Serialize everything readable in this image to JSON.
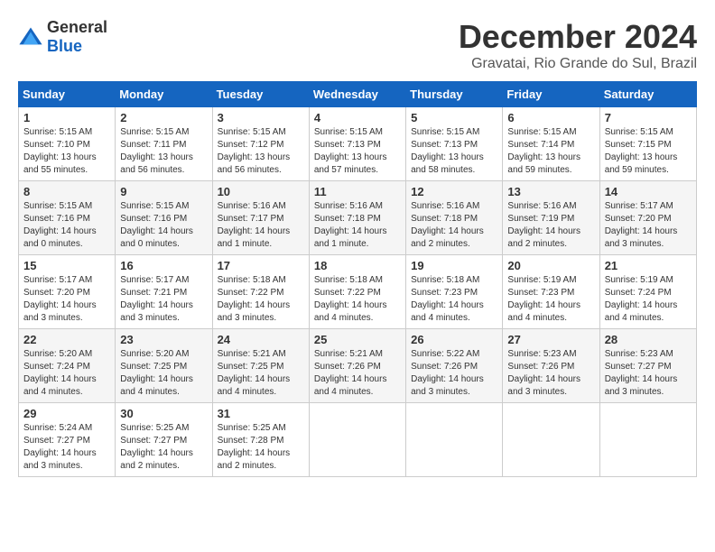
{
  "header": {
    "logo": {
      "general": "General",
      "blue": "Blue"
    },
    "title": "December 2024",
    "location": "Gravatai, Rio Grande do Sul, Brazil"
  },
  "weekdays": [
    "Sunday",
    "Monday",
    "Tuesday",
    "Wednesday",
    "Thursday",
    "Friday",
    "Saturday"
  ],
  "weeks": [
    [
      {
        "day": "1",
        "sunrise": "Sunrise: 5:15 AM",
        "sunset": "Sunset: 7:10 PM",
        "daylight": "Daylight: 13 hours and 55 minutes."
      },
      {
        "day": "2",
        "sunrise": "Sunrise: 5:15 AM",
        "sunset": "Sunset: 7:11 PM",
        "daylight": "Daylight: 13 hours and 56 minutes."
      },
      {
        "day": "3",
        "sunrise": "Sunrise: 5:15 AM",
        "sunset": "Sunset: 7:12 PM",
        "daylight": "Daylight: 13 hours and 56 minutes."
      },
      {
        "day": "4",
        "sunrise": "Sunrise: 5:15 AM",
        "sunset": "Sunset: 7:13 PM",
        "daylight": "Daylight: 13 hours and 57 minutes."
      },
      {
        "day": "5",
        "sunrise": "Sunrise: 5:15 AM",
        "sunset": "Sunset: 7:13 PM",
        "daylight": "Daylight: 13 hours and 58 minutes."
      },
      {
        "day": "6",
        "sunrise": "Sunrise: 5:15 AM",
        "sunset": "Sunset: 7:14 PM",
        "daylight": "Daylight: 13 hours and 59 minutes."
      },
      {
        "day": "7",
        "sunrise": "Sunrise: 5:15 AM",
        "sunset": "Sunset: 7:15 PM",
        "daylight": "Daylight: 13 hours and 59 minutes."
      }
    ],
    [
      {
        "day": "8",
        "sunrise": "Sunrise: 5:15 AM",
        "sunset": "Sunset: 7:16 PM",
        "daylight": "Daylight: 14 hours and 0 minutes."
      },
      {
        "day": "9",
        "sunrise": "Sunrise: 5:15 AM",
        "sunset": "Sunset: 7:16 PM",
        "daylight": "Daylight: 14 hours and 0 minutes."
      },
      {
        "day": "10",
        "sunrise": "Sunrise: 5:16 AM",
        "sunset": "Sunset: 7:17 PM",
        "daylight": "Daylight: 14 hours and 1 minute."
      },
      {
        "day": "11",
        "sunrise": "Sunrise: 5:16 AM",
        "sunset": "Sunset: 7:18 PM",
        "daylight": "Daylight: 14 hours and 1 minute."
      },
      {
        "day": "12",
        "sunrise": "Sunrise: 5:16 AM",
        "sunset": "Sunset: 7:18 PM",
        "daylight": "Daylight: 14 hours and 2 minutes."
      },
      {
        "day": "13",
        "sunrise": "Sunrise: 5:16 AM",
        "sunset": "Sunset: 7:19 PM",
        "daylight": "Daylight: 14 hours and 2 minutes."
      },
      {
        "day": "14",
        "sunrise": "Sunrise: 5:17 AM",
        "sunset": "Sunset: 7:20 PM",
        "daylight": "Daylight: 14 hours and 3 minutes."
      }
    ],
    [
      {
        "day": "15",
        "sunrise": "Sunrise: 5:17 AM",
        "sunset": "Sunset: 7:20 PM",
        "daylight": "Daylight: 14 hours and 3 minutes."
      },
      {
        "day": "16",
        "sunrise": "Sunrise: 5:17 AM",
        "sunset": "Sunset: 7:21 PM",
        "daylight": "Daylight: 14 hours and 3 minutes."
      },
      {
        "day": "17",
        "sunrise": "Sunrise: 5:18 AM",
        "sunset": "Sunset: 7:22 PM",
        "daylight": "Daylight: 14 hours and 3 minutes."
      },
      {
        "day": "18",
        "sunrise": "Sunrise: 5:18 AM",
        "sunset": "Sunset: 7:22 PM",
        "daylight": "Daylight: 14 hours and 4 minutes."
      },
      {
        "day": "19",
        "sunrise": "Sunrise: 5:18 AM",
        "sunset": "Sunset: 7:23 PM",
        "daylight": "Daylight: 14 hours and 4 minutes."
      },
      {
        "day": "20",
        "sunrise": "Sunrise: 5:19 AM",
        "sunset": "Sunset: 7:23 PM",
        "daylight": "Daylight: 14 hours and 4 minutes."
      },
      {
        "day": "21",
        "sunrise": "Sunrise: 5:19 AM",
        "sunset": "Sunset: 7:24 PM",
        "daylight": "Daylight: 14 hours and 4 minutes."
      }
    ],
    [
      {
        "day": "22",
        "sunrise": "Sunrise: 5:20 AM",
        "sunset": "Sunset: 7:24 PM",
        "daylight": "Daylight: 14 hours and 4 minutes."
      },
      {
        "day": "23",
        "sunrise": "Sunrise: 5:20 AM",
        "sunset": "Sunset: 7:25 PM",
        "daylight": "Daylight: 14 hours and 4 minutes."
      },
      {
        "day": "24",
        "sunrise": "Sunrise: 5:21 AM",
        "sunset": "Sunset: 7:25 PM",
        "daylight": "Daylight: 14 hours and 4 minutes."
      },
      {
        "day": "25",
        "sunrise": "Sunrise: 5:21 AM",
        "sunset": "Sunset: 7:26 PM",
        "daylight": "Daylight: 14 hours and 4 minutes."
      },
      {
        "day": "26",
        "sunrise": "Sunrise: 5:22 AM",
        "sunset": "Sunset: 7:26 PM",
        "daylight": "Daylight: 14 hours and 3 minutes."
      },
      {
        "day": "27",
        "sunrise": "Sunrise: 5:23 AM",
        "sunset": "Sunset: 7:26 PM",
        "daylight": "Daylight: 14 hours and 3 minutes."
      },
      {
        "day": "28",
        "sunrise": "Sunrise: 5:23 AM",
        "sunset": "Sunset: 7:27 PM",
        "daylight": "Daylight: 14 hours and 3 minutes."
      }
    ],
    [
      {
        "day": "29",
        "sunrise": "Sunrise: 5:24 AM",
        "sunset": "Sunset: 7:27 PM",
        "daylight": "Daylight: 14 hours and 3 minutes."
      },
      {
        "day": "30",
        "sunrise": "Sunrise: 5:25 AM",
        "sunset": "Sunset: 7:27 PM",
        "daylight": "Daylight: 14 hours and 2 minutes."
      },
      {
        "day": "31",
        "sunrise": "Sunrise: 5:25 AM",
        "sunset": "Sunset: 7:28 PM",
        "daylight": "Daylight: 14 hours and 2 minutes."
      },
      null,
      null,
      null,
      null
    ]
  ]
}
